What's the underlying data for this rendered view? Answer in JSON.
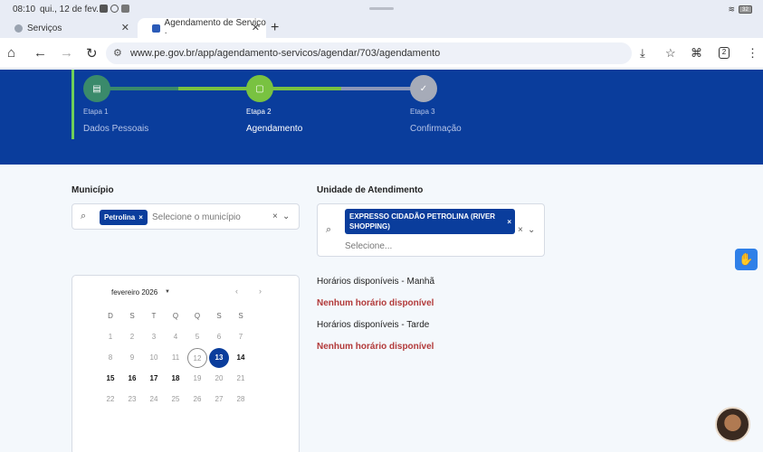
{
  "status": {
    "time": "08:10",
    "date": "qui., 12 de fev.",
    "battery": "32"
  },
  "tabs": [
    {
      "label": "Serviços",
      "active": false
    },
    {
      "label": "Agendamento de Serviço ·",
      "active": true
    }
  ],
  "address": {
    "url": "www.pe.gov.br/app/agendamento-servicos/agendar/703/agendamento",
    "tab_count": "2"
  },
  "steps": [
    {
      "number": "Etapa 1",
      "title": "Dados Pessoais",
      "color": "#3a8a6b"
    },
    {
      "number": "Etapa 2",
      "title": "Agendamento",
      "color": "#79c241"
    },
    {
      "number": "Etapa 3",
      "title": "Confirmação",
      "color": "#a6abb8"
    }
  ],
  "form": {
    "municipio": {
      "label": "Município",
      "chip": "Petrolina",
      "placeholder": "Selecione o município"
    },
    "unidade": {
      "label": "Unidade de Atendimento",
      "chip_line1": "EXPRESSO CIDADÃO PETROLINA (RIVER",
      "chip_line2": "SHOPPING)",
      "placeholder": "Selecione..."
    }
  },
  "calendar": {
    "month": "fevereiro 2026",
    "weekdays": [
      "D",
      "S",
      "T",
      "Q",
      "Q",
      "S",
      "S"
    ],
    "weeks": [
      [
        "1",
        "2",
        "3",
        "4",
        "5",
        "6",
        "7"
      ],
      [
        "8",
        "9",
        "10",
        "11",
        "12",
        "13",
        "14"
      ],
      [
        "15",
        "16",
        "17",
        "18",
        "19",
        "20",
        "21"
      ],
      [
        "22",
        "23",
        "24",
        "25",
        "26",
        "27",
        "28"
      ]
    ],
    "available": [
      "13",
      "14",
      "15",
      "16",
      "17",
      "18"
    ],
    "today": "12",
    "selected": "13"
  },
  "times": {
    "morning_title": "Horários disponíveis - Manhã",
    "morning_empty": "Nenhum horário disponível",
    "afternoon_title": "Horários disponíveis - Tarde",
    "afternoon_empty": "Nenhum horário disponível"
  }
}
